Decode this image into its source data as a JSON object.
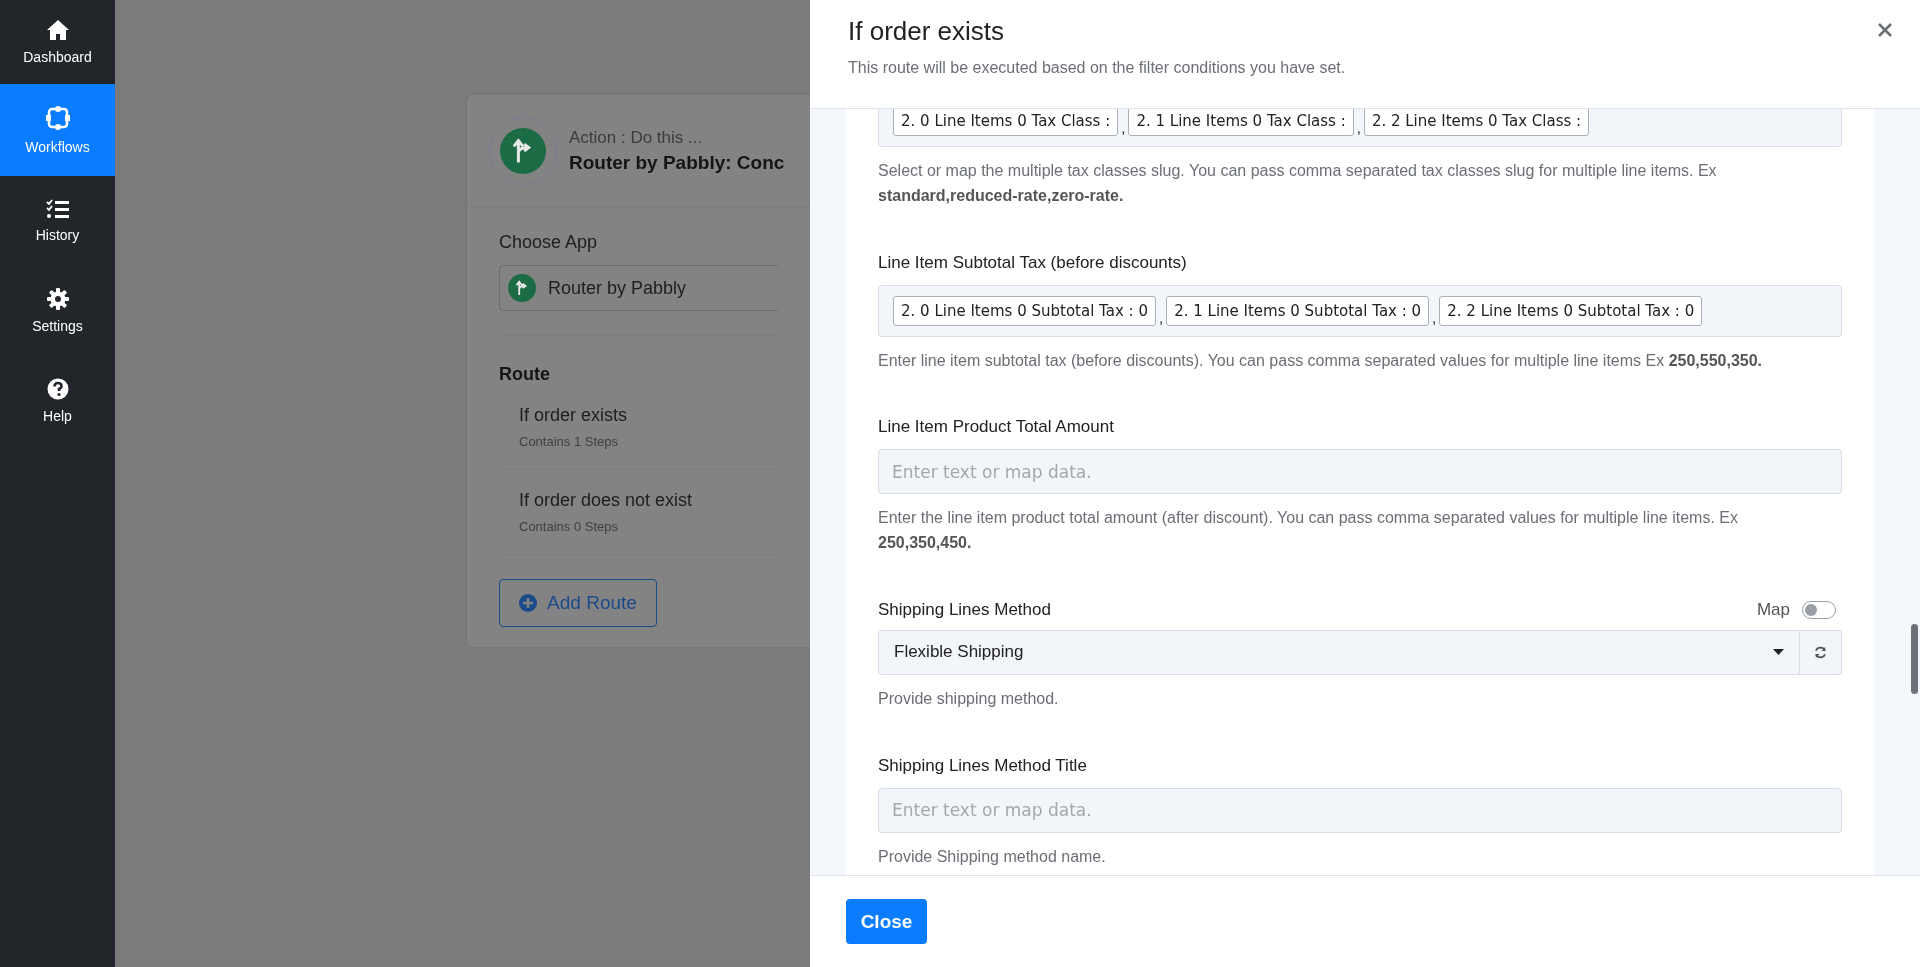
{
  "sidebar": {
    "items": [
      {
        "label": "Dashboard",
        "kind": "home",
        "selected": false
      },
      {
        "label": "Workflows",
        "kind": "workflow",
        "selected": true
      },
      {
        "label": "History",
        "kind": "history",
        "selected": false
      },
      {
        "label": "Settings",
        "kind": "settings",
        "selected": false
      },
      {
        "label": "Help",
        "kind": "help",
        "selected": false
      }
    ]
  },
  "action_card": {
    "caption": "Action : Do this ...",
    "title": "Router by Pabbly: Conc",
    "choose_app_label": "Choose App",
    "app": "Router by Pabbly",
    "route_heading": "Route",
    "routes": [
      {
        "name": "If order exists",
        "steps": "Contains 1 Steps"
      },
      {
        "name": "If order does not exist",
        "steps": "Contains 0 Steps"
      }
    ],
    "add_button": "Add Route"
  },
  "drawer": {
    "title": "If order exists",
    "subtitle": "This route will be executed based on the filter conditions you have set.",
    "fields": [
      {
        "kind": "tags",
        "separator": ",",
        "tags": [
          "2. 0 Line Items 0 Tax Class :",
          "2. 1 Line Items 0 Tax Class :",
          "2. 2 Line Items 0 Tax Class :"
        ],
        "help": "Select or map the multiple tax classes slug. You can pass comma separated tax classes slug for multiple line items. Ex **standard,reduced-rate,zero-rate.**"
      },
      {
        "kind": "tags",
        "label": "Line Item Subtotal Tax (before discounts)",
        "separator": ",",
        "tags": [
          "2. 0 Line Items 0 Subtotal Tax : 0",
          "2. 1 Line Items 0 Subtotal Tax : 0",
          "2. 2 Line Items 0 Subtotal Tax : 0"
        ],
        "help": "Enter line item subtotal tax (before discounts). You can pass comma separated values for multiple line items Ex **250,550,350.**"
      },
      {
        "kind": "text",
        "label": "Line Item Product Total Amount",
        "placeholder": "Enter text or map data.",
        "help": "Enter the line item product total amount (after discount). You can pass comma separated values for multiple line items. Ex **250,350,450.**"
      },
      {
        "kind": "select",
        "label": "Shipping Lines Method",
        "map_label": "Map",
        "map_on": false,
        "value": "Flexible Shipping",
        "help": "Provide shipping method."
      },
      {
        "kind": "text",
        "label": "Shipping Lines Method Title",
        "placeholder": "Enter text or map data.",
        "help": "Provide Shipping method name."
      }
    ],
    "close_button": "Close"
  }
}
